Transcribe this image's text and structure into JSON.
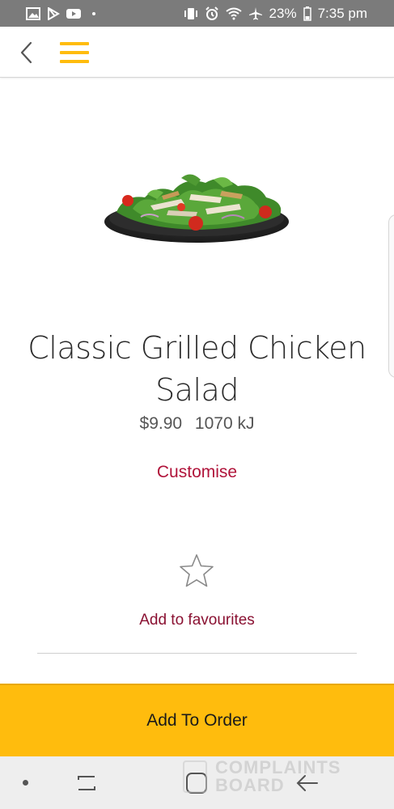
{
  "status_bar": {
    "left_icons": [
      "gallery-icon",
      "play-store-icon",
      "youtube-icon",
      "dot-icon"
    ],
    "right_icons": [
      "vibrate-icon",
      "alarm-icon",
      "wifi-icon",
      "airplane-icon",
      "battery-icon"
    ],
    "battery": "23%",
    "time": "7:35 pm"
  },
  "header": {
    "back_icon": "back-chevron-icon",
    "menu_icon": "hamburger-menu-icon",
    "accent_color": "#ffbc0d"
  },
  "product": {
    "image": "salad-plate-image",
    "title": "Classic Grilled Chicken Salad",
    "price": "$9.90",
    "energy": "1070 kJ",
    "customise_label": "Customise",
    "favourite_icon": "star-outline-icon",
    "favourite_label": "Add to favourites"
  },
  "cta": {
    "add_to_order_label": "Add To Order",
    "background_color": "#ffbc0d"
  },
  "nav_bar": {
    "icons": [
      "dot-icon",
      "recents-icon",
      "home-icon",
      "back-arrow-icon"
    ]
  },
  "watermark": {
    "line1": "COMPLAINTS",
    "line2": "BOARD"
  },
  "colors": {
    "brand_red": "#b0133a",
    "title_text": "#2b2b2b",
    "status_bar_bg": "#7b7b7b"
  }
}
